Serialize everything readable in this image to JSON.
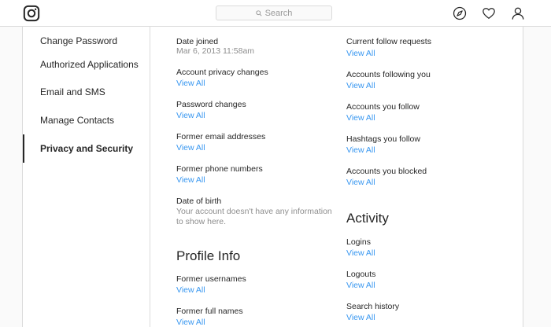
{
  "header": {
    "search_placeholder": "Search"
  },
  "sidebar": {
    "items": [
      {
        "label": "Change Password"
      },
      {
        "label": "Authorized Applications"
      },
      {
        "label": "Email and SMS"
      },
      {
        "label": "Manage Contacts"
      },
      {
        "label": "Privacy and Security"
      }
    ]
  },
  "left_column": {
    "date_joined_label": "Date joined",
    "date_joined_value": "Mar 6, 2013 11:58am",
    "items": [
      {
        "label": "Account privacy changes",
        "link": "View All"
      },
      {
        "label": "Password changes",
        "link": "View All"
      },
      {
        "label": "Former email addresses",
        "link": "View All"
      },
      {
        "label": "Former phone numbers",
        "link": "View All"
      }
    ],
    "dob_label": "Date of birth",
    "dob_note": "Your account doesn't have any information to show here.",
    "profile_heading": "Profile Info",
    "profile_items": [
      {
        "label": "Former usernames",
        "link": "View All"
      },
      {
        "label": "Former full names",
        "link": "View All"
      }
    ]
  },
  "right_column": {
    "items": [
      {
        "label": "Current follow requests",
        "link": "View All"
      },
      {
        "label": "Accounts following you",
        "link": "View All"
      },
      {
        "label": "Accounts you follow",
        "link": "View All"
      },
      {
        "label": "Hashtags you follow",
        "link": "View All"
      },
      {
        "label": "Accounts you blocked",
        "link": "View All"
      }
    ],
    "activity_heading": "Activity",
    "activity_items": [
      {
        "label": "Logins",
        "link": "View All"
      },
      {
        "label": "Logouts",
        "link": "View All"
      },
      {
        "label": "Search history",
        "link": "View All"
      }
    ]
  }
}
